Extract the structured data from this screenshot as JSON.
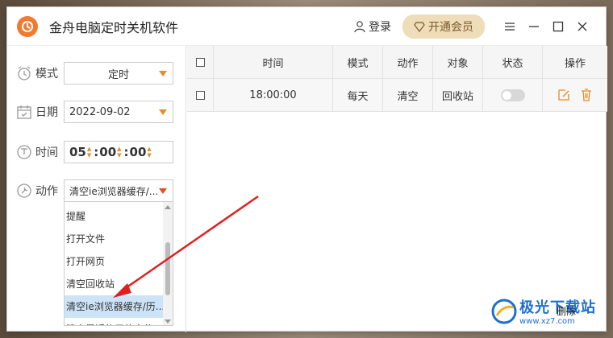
{
  "app": {
    "title": "金舟电脑定时关机软件"
  },
  "header": {
    "login_label": "登录",
    "vip_label": "开通会员"
  },
  "settings": {
    "mode": {
      "label": "模式",
      "value": "定时"
    },
    "date": {
      "label": "日期",
      "value": "2022-09-02"
    },
    "time": {
      "label": "时间",
      "hour": "05",
      "minute": "00",
      "second": "00"
    },
    "action": {
      "label": "动作",
      "value": "清空ie浏览器缓存/..."
    }
  },
  "action_options": [
    "提醒",
    "打开文件",
    "打开网页",
    "清空回收站",
    "清空ie浏览器缓存/历...",
    "清空最近使用的文件..."
  ],
  "table": {
    "headers": [
      "时间",
      "模式",
      "动作",
      "对象",
      "状态",
      "操作"
    ],
    "rows": [
      {
        "time": "18:00:00",
        "mode": "每天",
        "action": "清空",
        "target": "回收站",
        "enabled": false
      }
    ]
  },
  "tooltip": {
    "delete_label": "删除"
  },
  "watermark": {
    "text": "极光下载站",
    "url": "www.xz7.com"
  },
  "colors": {
    "accent": "#e88a2a",
    "logo": "#f07a30",
    "vip_bg": "#efdcb9",
    "arrow": "#e02020",
    "watermark": "#1e6fd0"
  }
}
